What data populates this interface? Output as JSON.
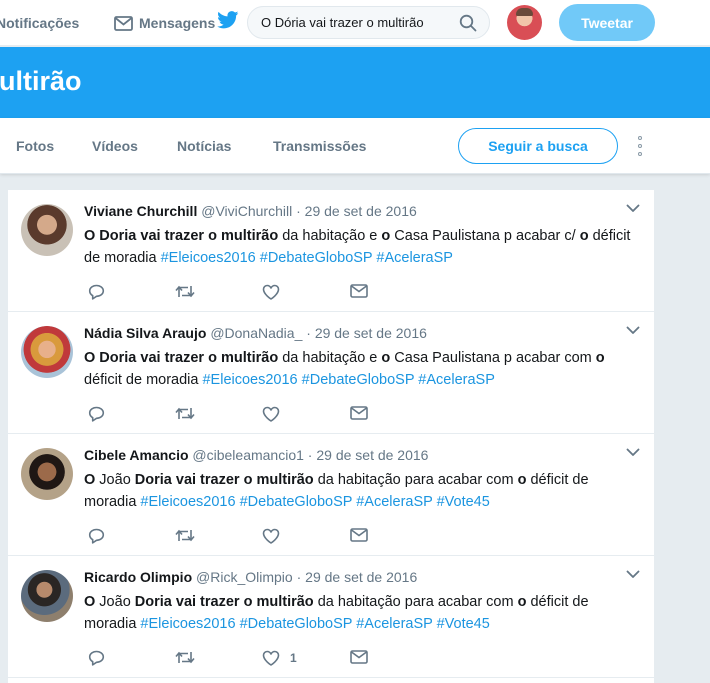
{
  "topnav": {
    "notifications": "Notificações",
    "messages": "Mensagens",
    "search_value": "O Dória vai trazer o multirão",
    "tweet_button": "Tweetar"
  },
  "banner": {
    "title": "ultirão"
  },
  "tabs": [
    {
      "label": "Fotos"
    },
    {
      "label": "Vídeos"
    },
    {
      "label": "Notícias"
    },
    {
      "label": "Transmissões"
    }
  ],
  "follow_button": "Seguir a busca",
  "colors": {
    "brand": "#1da1f2",
    "link": "#1b95e0",
    "muted": "#657786"
  },
  "icons": [
    "bell-icon",
    "envelope-icon",
    "twitter-bird-icon",
    "search-icon",
    "more-icon",
    "chevron-down-icon",
    "reply-icon",
    "retweet-icon",
    "heart-icon",
    "direct-message-icon"
  ],
  "tweets": [
    {
      "name": "Viviane Churchill",
      "handle": "@ViviChurchill",
      "sep": "·",
      "date": "29 de set de 2016",
      "text": {
        "b1": "O Doria vai trazer o multirão",
        "t1": " da habitação e ",
        "b2": "o",
        "t2": " Casa Paulistana p acabar c/ ",
        "b3": "o",
        "t3": " déficit de moradia "
      },
      "hashtags": [
        "#Eleicoes2016",
        "#DebateGloboSP",
        "#AceleraSP"
      ],
      "likes": ""
    },
    {
      "name": "Nádia Silva Araujo",
      "handle": "@DonaNadia_",
      "sep": "·",
      "date": "29 de set de 2016",
      "text": {
        "b1": "O Doria vai trazer o multirão",
        "t1": " da habitação e ",
        "b2": "o",
        "t2": " Casa Paulistana p acabar com ",
        "b3": "o",
        "t3": " déficit de moradia "
      },
      "hashtags": [
        "#Eleicoes2016",
        "#DebateGloboSP",
        "#AceleraSP"
      ],
      "likes": ""
    },
    {
      "name": "Cibele Amancio",
      "handle": "@cibeleamancio1",
      "sep": "·",
      "date": "29 de set de 2016",
      "text": {
        "b1": "O",
        "t1": " João ",
        "b2": "Doria vai trazer o multirão",
        "t2": " da habitação para acabar com ",
        "b3": "o",
        "t3": " déficit de moradia "
      },
      "hashtags": [
        "#Eleicoes2016",
        "#DebateGloboSP",
        "#AceleraSP",
        "#Vote45"
      ],
      "likes": ""
    },
    {
      "name": "Ricardo Olimpio",
      "handle": "@Rick_Olimpio",
      "sep": "·",
      "date": "29 de set de 2016",
      "text": {
        "b1": "O",
        "t1": " João ",
        "b2": "Doria vai trazer o multirão",
        "t2": " da habitação para acabar com ",
        "b3": "o",
        "t3": " déficit de moradia "
      },
      "hashtags": [
        "#Eleicoes2016",
        "#DebateGloboSP",
        "#AceleraSP",
        "#Vote45"
      ],
      "likes": "1"
    }
  ]
}
